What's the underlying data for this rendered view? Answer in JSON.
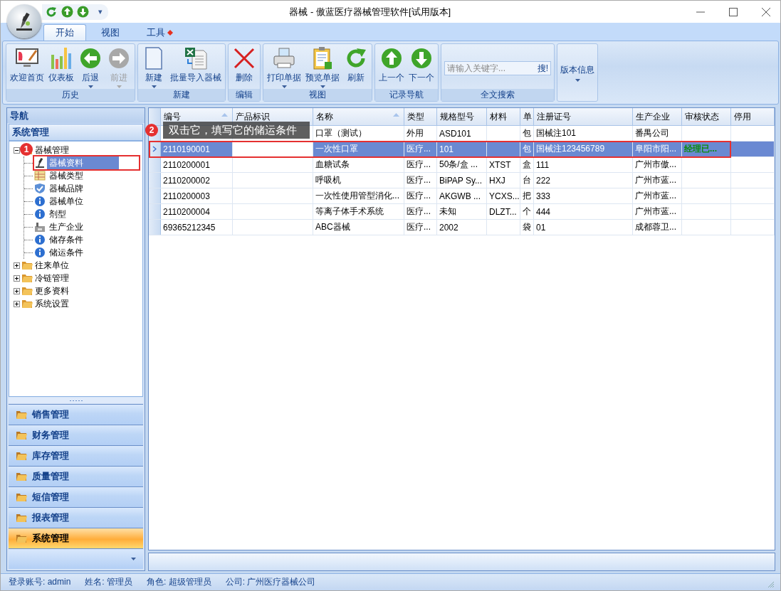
{
  "window": {
    "title": "器械 - 傲蓝医疗器械管理软件[试用版本]"
  },
  "quick_access": {
    "menu_glyph": "▾"
  },
  "tabs": [
    {
      "label": "开始",
      "selected": true,
      "marked": false
    },
    {
      "label": "视图",
      "selected": false,
      "marked": false
    },
    {
      "label": "工具",
      "selected": false,
      "marked": true
    }
  ],
  "ribbon": [
    {
      "label": "历史",
      "buttons": [
        {
          "label": "欢迎首页",
          "dropdown": false,
          "disabled": false
        },
        {
          "label": "仪表板",
          "dropdown": false,
          "disabled": false
        },
        {
          "label": "后退",
          "dropdown": true,
          "disabled": false
        },
        {
          "label": "前进",
          "dropdown": true,
          "disabled": true
        }
      ]
    },
    {
      "label": "新建",
      "buttons": [
        {
          "label": "新建",
          "dropdown": true,
          "disabled": false
        },
        {
          "label": "批量导入器械",
          "dropdown": false,
          "disabled": false
        }
      ]
    },
    {
      "label": "编辑",
      "buttons": [
        {
          "label": "删除",
          "dropdown": false,
          "disabled": false
        }
      ]
    },
    {
      "label": "视图",
      "buttons": [
        {
          "label": "打印单据",
          "dropdown": true,
          "disabled": false
        },
        {
          "label": "预览单据",
          "dropdown": true,
          "disabled": false
        },
        {
          "label": "刷新",
          "dropdown": false,
          "disabled": false
        }
      ]
    },
    {
      "label": "记录导航",
      "buttons": [
        {
          "label": "上一个",
          "dropdown": false,
          "disabled": false
        },
        {
          "label": "下一个",
          "dropdown": false,
          "disabled": false
        }
      ]
    }
  ],
  "search": {
    "group_label": "全文搜索",
    "placeholder": "请输入关键字...",
    "button": "搜!"
  },
  "version_button": {
    "label": "版本信息",
    "dropdown": true
  },
  "nav": {
    "title": "导航",
    "section": "系统管理",
    "tree": [
      {
        "label": "器械管理",
        "expanded": true,
        "children": [
          {
            "label": "器械资料",
            "selected": true
          },
          {
            "label": "器械类型",
            "selected": false
          },
          {
            "label": "器械品牌",
            "selected": false
          },
          {
            "label": "器械单位",
            "selected": false
          },
          {
            "label": "剂型",
            "selected": false
          },
          {
            "label": "生产企业",
            "selected": false
          },
          {
            "label": "储存条件",
            "selected": false
          },
          {
            "label": "储运条件",
            "selected": false
          }
        ]
      },
      {
        "label": "往来单位",
        "expanded": false
      },
      {
        "label": "冷链管理",
        "expanded": false
      },
      {
        "label": "更多资料",
        "expanded": false
      },
      {
        "label": "系统设置",
        "expanded": false
      }
    ],
    "groups": [
      {
        "label": "销售管理",
        "selected": false
      },
      {
        "label": "财务管理",
        "selected": false
      },
      {
        "label": "库存管理",
        "selected": false
      },
      {
        "label": "质量管理",
        "selected": false
      },
      {
        "label": "短信管理",
        "selected": false
      },
      {
        "label": "报表管理",
        "selected": false
      },
      {
        "label": "系统管理",
        "selected": true
      }
    ]
  },
  "table": {
    "columns": [
      {
        "label": "编号",
        "sorted": true
      },
      {
        "label": "产品标识",
        "sorted": false
      },
      {
        "label": "名称",
        "sorted": true
      },
      {
        "label": "类型",
        "sorted": false
      },
      {
        "label": "规格型号",
        "sorted": false
      },
      {
        "label": "材料",
        "sorted": false
      },
      {
        "label": "单",
        "sorted": false
      },
      {
        "label": "注册证号",
        "sorted": false
      },
      {
        "label": "生产企业",
        "sorted": false
      },
      {
        "label": "审核状态",
        "sorted": false
      },
      {
        "label": "停用",
        "sorted": false
      }
    ],
    "rows": [
      {
        "selected": false,
        "cells": [
          null,
          null,
          "口罩（测试）",
          "外用",
          "ASD101",
          null,
          "包",
          "国械注101",
          "番禺公司",
          null,
          null
        ]
      },
      {
        "selected": true,
        "cells": [
          "2110190001",
          null,
          "一次性口罩",
          "医疗...",
          "101",
          null,
          "包",
          "国械注123456789",
          "阜阳市阳...",
          "经理已...",
          null
        ]
      },
      {
        "selected": false,
        "cells": [
          "2110200001",
          null,
          "血糖试条",
          "医疗...",
          "50条/盒 ...",
          "XTST",
          "盒",
          "111",
          "广州市傲...",
          null,
          null
        ]
      },
      {
        "selected": false,
        "cells": [
          "2110200002",
          null,
          "呼吸机",
          "医疗...",
          "BiPAP Sy...",
          "HXJ",
          "台",
          "222",
          "广州市蓝...",
          null,
          null
        ]
      },
      {
        "selected": false,
        "cells": [
          "2110200003",
          null,
          "一次性使用管型消化...",
          "医疗...",
          "AKGWB ...",
          "YCXS...",
          "把",
          "333",
          "广州市蓝...",
          null,
          null
        ]
      },
      {
        "selected": false,
        "cells": [
          "2110200004",
          null,
          "等离子体手术系统",
          "医疗...",
          "未知",
          "DLZT...",
          "个",
          "444",
          "广州市蓝...",
          null,
          null
        ]
      },
      {
        "selected": false,
        "cells": [
          "69365212345",
          null,
          "ABC器械",
          "医疗...",
          "2002",
          null,
          "袋",
          "01",
          "成都蓉卫...",
          null,
          null
        ]
      }
    ]
  },
  "annotations": [
    {
      "number": "1"
    },
    {
      "number": "2",
      "text": "双击它，填写它的储运条件"
    }
  ],
  "status_bar": [
    "登录账号: admin",
    "姓名: 管理员",
    "角色: 超级管理员",
    "公司: 广州医疗器械公司"
  ]
}
